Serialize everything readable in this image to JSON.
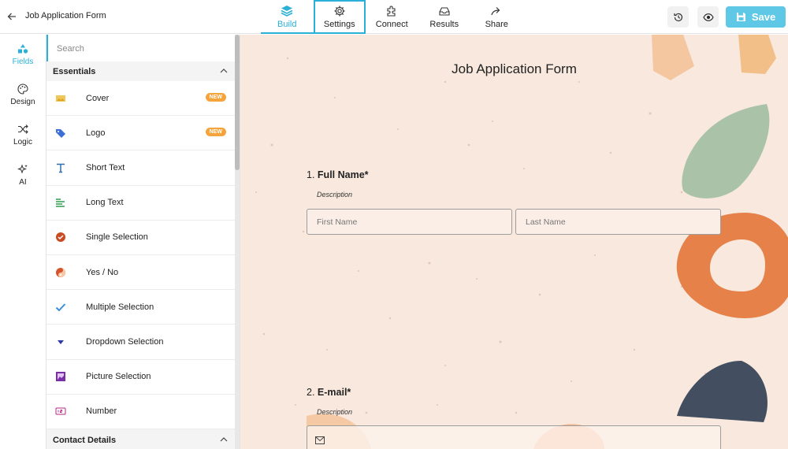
{
  "header": {
    "form_name": "Job Application Form",
    "tabs": [
      {
        "label": "Build",
        "icon": "layers-icon"
      },
      {
        "label": "Settings",
        "icon": "gear-icon"
      },
      {
        "label": "Connect",
        "icon": "puzzle-icon"
      },
      {
        "label": "Results",
        "icon": "inbox-icon"
      },
      {
        "label": "Share",
        "icon": "share-icon"
      }
    ],
    "save_label": "Save",
    "accent_color": "#2bb0d8"
  },
  "rail": {
    "items": [
      {
        "label": "Fields",
        "icon": "shapes-icon"
      },
      {
        "label": "Design",
        "icon": "palette-icon"
      },
      {
        "label": "Logic",
        "icon": "shuffle-icon"
      },
      {
        "label": "AI",
        "icon": "sparkle-icon"
      }
    ]
  },
  "panel": {
    "search_placeholder": "Search",
    "sections": {
      "essentials": "Essentials",
      "contact": "Contact Details"
    },
    "items": [
      {
        "label": "Cover",
        "badge": "NEW",
        "icon": "image-icon"
      },
      {
        "label": "Logo",
        "badge": "NEW",
        "icon": "tag-icon"
      },
      {
        "label": "Short Text",
        "icon": "text-t-icon"
      },
      {
        "label": "Long Text",
        "icon": "long-text-icon"
      },
      {
        "label": "Single Selection",
        "icon": "check-circle-icon"
      },
      {
        "label": "Yes / No",
        "icon": "yes-no-icon"
      },
      {
        "label": "Multiple Selection",
        "icon": "check-icon"
      },
      {
        "label": "Dropdown Selection",
        "icon": "dropdown-icon"
      },
      {
        "label": "Picture Selection",
        "icon": "picture-icon"
      },
      {
        "label": "Number",
        "icon": "number-icon"
      }
    ]
  },
  "form": {
    "title": "Job Application Form",
    "q1": {
      "number": "1.",
      "label": "Full Name*",
      "description": "Description",
      "first_placeholder": "First Name",
      "last_placeholder": "Last Name"
    },
    "q2": {
      "number": "2.",
      "label": "E-mail*",
      "description": "Description"
    }
  }
}
